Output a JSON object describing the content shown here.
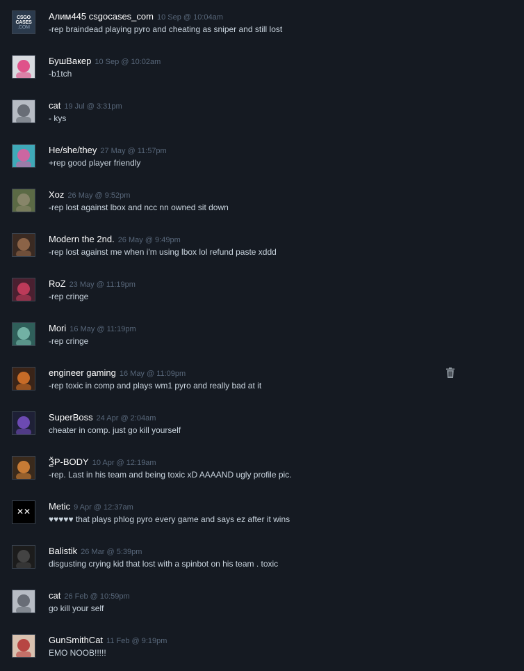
{
  "comments": [
    {
      "author": "Алим445 csgocases_com",
      "timestamp": "10 Sep @ 10:04am",
      "text": "-rep braindead playing pyro and cheating as sniper and still lost",
      "avatar": {
        "bg": "#2b3a4c",
        "fg": "#8fa3b8",
        "icon": "csgocases-logo-avatar",
        "logo_lines": [
          "CSGO",
          "CASES",
          ".COM"
        ]
      }
    },
    {
      "author": "БушВакер",
      "timestamp": "10 Sep @ 10:02am",
      "text": "-b1tch",
      "avatar": {
        "bg": "#d8dbe0",
        "fg": "#e0397a",
        "icon": "dog-sunglasses-avatar"
      }
    },
    {
      "author": "cat",
      "timestamp": "19 Jul @ 3:31pm",
      "text": "- kys",
      "avatar": {
        "bg": "#b7bcc4",
        "fg": "#5a5f68",
        "icon": "anime-face-avatar"
      }
    },
    {
      "author": "He/she/they",
      "timestamp": "27 May @ 11:57pm",
      "text": "+rep good player friendly",
      "avatar": {
        "bg": "#3fa9b8",
        "fg": "#e55a9c",
        "icon": "cartoon-face-avatar"
      }
    },
    {
      "author": "Xoz",
      "timestamp": "26 May @ 9:52pm",
      "text": "-rep lost against lbox and ncc nn owned sit down",
      "avatar": {
        "bg": "#5b6a45",
        "fg": "#8f8a70",
        "icon": "landscape-avatar"
      }
    },
    {
      "author": "Modern the 2nd.",
      "timestamp": "26 May @ 9:49pm",
      "text": "-rep lost against me when i'm using lbox lol refund paste xddd",
      "avatar": {
        "bg": "#3a2a22",
        "fg": "#9a6d4e",
        "icon": "soldier-avatar"
      }
    },
    {
      "author": "RoZ",
      "timestamp": "23 May @ 11:19pm",
      "text": "-rep cringe",
      "avatar": {
        "bg": "#4a2030",
        "fg": "#d04060",
        "icon": "anime-girl-avatar"
      }
    },
    {
      "author": "Mori",
      "timestamp": "16 May @ 11:19pm",
      "text": "-rep cringe",
      "avatar": {
        "bg": "#2f5f5a",
        "fg": "#7ec0b2",
        "icon": "creature-avatar"
      }
    },
    {
      "author": "engineer gaming",
      "timestamp": "16 May @ 11:09pm",
      "text": "-rep toxic in comp and plays wm1 pyro and really bad at it",
      "avatar": {
        "bg": "#3a2418",
        "fg": "#e0782a",
        "icon": "engineer-avatar"
      },
      "deletable": true
    },
    {
      "author": "SuperBoss",
      "timestamp": "24 Apr @ 2:04am",
      "text": "cheater in comp. just go kill yourself",
      "avatar": {
        "bg": "#1e2036",
        "fg": "#7a52c8",
        "icon": "purple-boss-avatar"
      }
    },
    {
      "author": "ѮP-BODY",
      "timestamp": "10 Apr @ 12:19am",
      "text": "-rep. Last in his team and being toxic xD AAAAND ugly profile pic.",
      "avatar": {
        "bg": "#3a2a1c",
        "fg": "#e08a3a",
        "icon": "robot-avatar"
      }
    },
    {
      "author": "Metic",
      "timestamp": "9 Apr @ 12:37am",
      "text": "♥♥♥♥♥ that plays phlog pyro every game and says ez after it wins",
      "avatar": {
        "bg": "#000000",
        "fg": "#ffffff",
        "icon": "x-eyes-face-avatar"
      }
    },
    {
      "author": "Balistik",
      "timestamp": "26 Mar @ 5:39pm",
      "text": "disgusting crying kid that lost with a spinbot on his team . toxic",
      "avatar": {
        "bg": "#1c1c1c",
        "fg": "#4a4a4a",
        "icon": "dark-figure-avatar"
      }
    },
    {
      "author": "cat",
      "timestamp": "26 Feb @ 10:59pm",
      "text": "go kill your self",
      "avatar": {
        "bg": "#b7bcc4",
        "fg": "#5a5f68",
        "icon": "anime-face-avatar"
      }
    },
    {
      "author": "GunSmithCat",
      "timestamp": "11 Feb @ 9:19pm",
      "text": "EMO NOOB!!!!!",
      "avatar": {
        "bg": "#d9c2b0",
        "fg": "#b03030",
        "icon": "anime-character-avatar"
      }
    }
  ],
  "delete_icon": "trash-icon"
}
